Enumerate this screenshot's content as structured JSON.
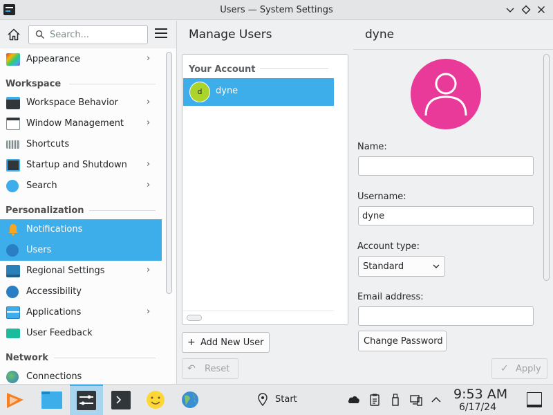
{
  "window": {
    "title": "Users — System Settings",
    "controls": [
      "minimize",
      "maximize",
      "close"
    ]
  },
  "sidebar": {
    "search_placeholder": "Search...",
    "items_top": [
      {
        "label": "Appearance",
        "icon": "appearance-icon",
        "chevron": true
      }
    ],
    "workspace_header": "Workspace",
    "workspace_items": [
      {
        "label": "Workspace Behavior",
        "icon": "workspace-behavior-icon",
        "chevron": true
      },
      {
        "label": "Window Management",
        "icon": "window-management-icon",
        "chevron": true
      },
      {
        "label": "Shortcuts",
        "icon": "keyboard-icon",
        "chevron": false
      },
      {
        "label": "Startup and Shutdown",
        "icon": "startup-icon",
        "chevron": true
      },
      {
        "label": "Search",
        "icon": "search-icon",
        "chevron": true
      }
    ],
    "personalization_header": "Personalization",
    "personalization_items": [
      {
        "label": "Notifications",
        "icon": "bell-icon",
        "chevron": false,
        "selected": true
      },
      {
        "label": "Users",
        "icon": "users-icon",
        "chevron": false,
        "selected": true
      },
      {
        "label": "Regional Settings",
        "icon": "regional-icon",
        "chevron": true
      },
      {
        "label": "Accessibility",
        "icon": "accessibility-icon",
        "chevron": false
      },
      {
        "label": "Applications",
        "icon": "applications-icon",
        "chevron": true
      },
      {
        "label": "User Feedback",
        "icon": "feedback-icon",
        "chevron": false
      }
    ],
    "network_header": "Network",
    "network_items": [
      {
        "label": "Connections",
        "icon": "globe-icon",
        "chevron": false
      }
    ]
  },
  "manage": {
    "title": "Manage Users",
    "section_header": "Your Account",
    "users": [
      {
        "initial": "d",
        "name": "dyne"
      }
    ],
    "add_button": "Add New User",
    "reset_button": "Reset"
  },
  "detail": {
    "title": "dyne",
    "name_label": "Name:",
    "name_value": "",
    "username_label": "Username:",
    "username_value": "dyne",
    "account_type_label": "Account type:",
    "account_type_value": "Standard",
    "email_label": "Email address:",
    "email_value": "",
    "change_password_button": "Change Password",
    "apply_button": "Apply",
    "avatar_color": "#e93a9a"
  },
  "taskbar": {
    "start_label": "Start",
    "time": "9:53 AM",
    "date": "6/17/24"
  },
  "colors": {
    "accent": "#3daee9",
    "avatar_small": "#aad42a"
  }
}
